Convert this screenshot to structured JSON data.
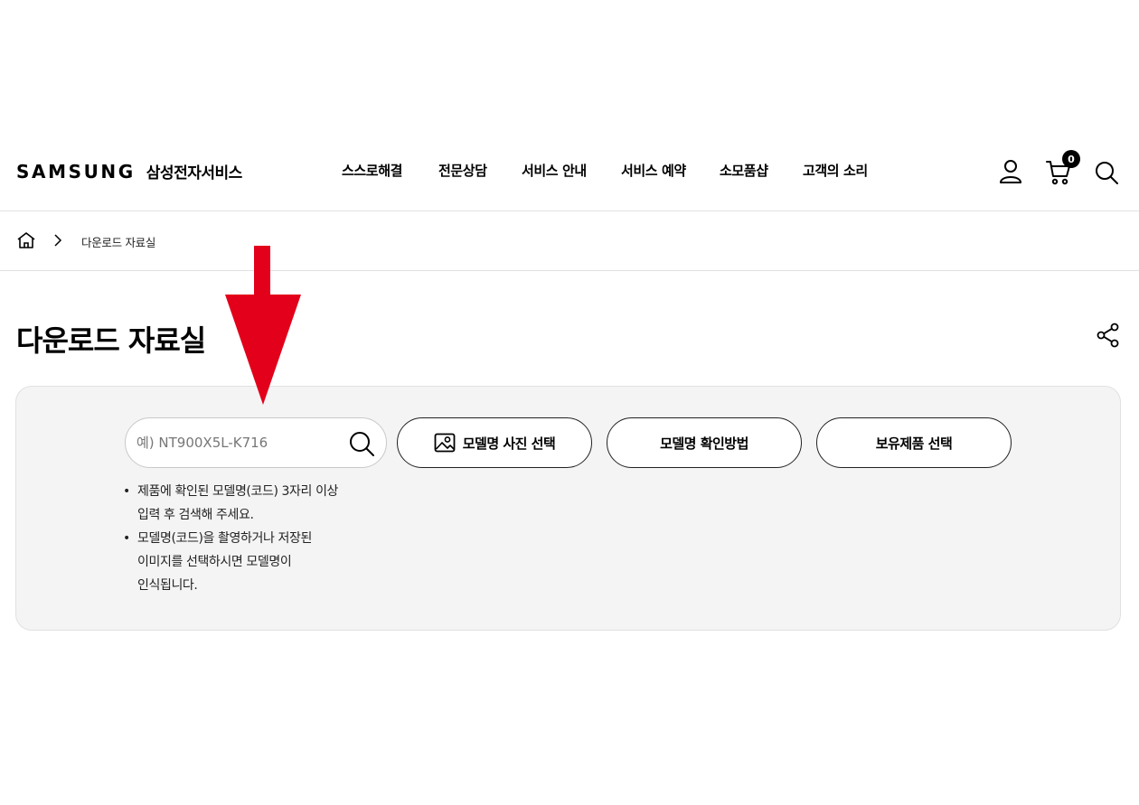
{
  "header": {
    "logo_wordmark": "SAMSUNG",
    "logo_subtitle": "삼성전자서비스",
    "nav": [
      {
        "label": "스스로해결"
      },
      {
        "label": "전문상담"
      },
      {
        "label": "서비스 안내"
      },
      {
        "label": "서비스 예약"
      },
      {
        "label": "소모품샵"
      },
      {
        "label": "고객의 소리"
      }
    ],
    "cart_count": "0",
    "icons": [
      "user-icon",
      "cart-icon",
      "search-icon"
    ]
  },
  "breadcrumb": {
    "icons": [
      "home-icon",
      "chevron-right-icon"
    ],
    "current": "다운로드 자료실"
  },
  "page": {
    "title": "다운로드 자료실",
    "share_icon": "share-icon"
  },
  "search": {
    "placeholder": "예) NT900X5L-K716",
    "value": "",
    "buttons": {
      "photo_select": "모델명 사진 선택",
      "how_to_check": "모델명 확인방법",
      "owned_products": "보유제품 선택"
    },
    "notes": [
      {
        "lines": [
          "제품에 확인된 모델명(코드) 3자리 이상",
          "입력 후 검색해 주세요."
        ]
      },
      {
        "lines": [
          "모델명(코드)을 촬영하거나 저장된",
          "이미지를 선택하시면 모델명이",
          "인식됩니다."
        ]
      }
    ]
  },
  "annotation": {
    "arrow_color": "#e3001b",
    "arrow_icon": "arrow-down-icon"
  },
  "colors": {
    "panel_background": "#f4f4f4",
    "text": "#000000",
    "divider": "#e2e2e2"
  }
}
